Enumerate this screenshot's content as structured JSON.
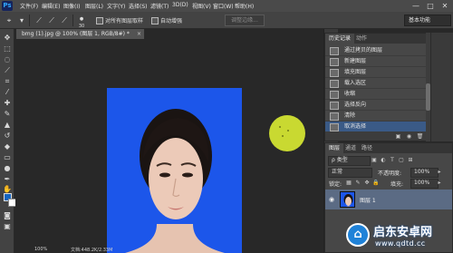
{
  "app": {
    "logo": "Ps"
  },
  "menu": [
    "文件(F)",
    "编辑(E)",
    "图像(I)",
    "图层(L)",
    "文字(Y)",
    "选择(S)",
    "滤镜(T)",
    "3D(D)",
    "视图(V)",
    "窗口(W)",
    "帮助(H)"
  ],
  "window_controls": {
    "minimize": "—",
    "maximize": "□",
    "close": "✕"
  },
  "options": {
    "brush_size": "30",
    "sample_all_layers": "对所有图层取样",
    "auto_enhance": "自动增强",
    "refine_edge": "调整边缘...",
    "workspace": "基本功能"
  },
  "document": {
    "tab_title": "bmg (1).jpg @ 100% (图层 1, RGB/8#) *",
    "close": "×",
    "status_zoom": "100%",
    "status_doc": "文档:448.2K/2.33M"
  },
  "history": {
    "tabs": [
      "历史记录",
      "动作"
    ],
    "items": [
      "通过拷贝的图层",
      "新建图层",
      "填充图层",
      "载入选区",
      "收缩",
      "选择反向",
      "清除",
      "取消选择"
    ],
    "active_index": 7
  },
  "layers": {
    "tabs": [
      "图层",
      "通道",
      "路径"
    ],
    "filter_kind": "ρ 类型",
    "blend_mode": "正常",
    "opacity_label": "不透明度:",
    "opacity_value": "100%",
    "lock_label": "锁定:",
    "fill_label": "填充:",
    "fill_value": "100%",
    "layer_name": "图层 1"
  },
  "watermark": {
    "name": "启东安卓网",
    "url": "www.qdtd.cc"
  },
  "colors": {
    "canvas_bg": "#1c56ea",
    "foreground": "#1565c0",
    "background": "#ffffff",
    "selection_circle": "#c9d931",
    "active_history": "#3a5a86"
  },
  "icons": {
    "tools": [
      "move-icon",
      "marquee-icon",
      "lasso-icon",
      "quick-select-icon",
      "crop-icon",
      "eyedropper-icon",
      "healing-icon",
      "brush-icon",
      "stamp-icon",
      "history-brush-icon",
      "eraser-icon",
      "gradient-icon",
      "blur-icon",
      "dodge-icon",
      "pen-icon",
      "type-icon",
      "path-select-icon",
      "shape-icon",
      "hand-icon",
      "zoom-icon"
    ]
  }
}
